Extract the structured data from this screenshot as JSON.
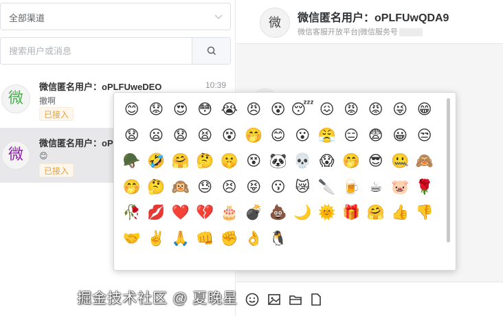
{
  "left": {
    "channel_select": {
      "value": "全部渠道"
    },
    "search": {
      "placeholder": "搜索用户或消息"
    },
    "conversations": [
      {
        "avatar": "微",
        "avatar_color": "#4caf50",
        "name": "微信匿名用户：oPLFUweDEO",
        "time": "10:39",
        "message": "撤啊",
        "badge": "已接入",
        "active": false
      },
      {
        "avatar": "微",
        "avatar_color": "#8e24aa",
        "name": "微信匿名用户：oPLFU",
        "time": "",
        "message": "😊",
        "badge": "已接入",
        "active": true
      }
    ]
  },
  "chat": {
    "avatar": "微",
    "title": "微信匿名用户：oPLFUwQDA9",
    "subtitle": "微信客服开放平台|微信服务号"
  },
  "emoji_picker": {
    "emojis": [
      "😊",
      "😟",
      "😍",
      "😳",
      "😭",
      "😠",
      "😵",
      "😴",
      "😖",
      "😡",
      "😡",
      "😜",
      "😁",
      "😧",
      "😦",
      "😧",
      "😫",
      "😵",
      "🤭",
      "😊",
      "😮",
      "😤",
      "😑",
      "😨",
      "😀",
      "😒",
      "🪖",
      "🤣",
      "🤗",
      "🤔",
      "🤫",
      "😵",
      "🐼",
      "💀",
      "😱",
      "🤭",
      "😎",
      "🤐",
      "🙈",
      "🤭",
      "🤔",
      "🙉",
      "😓",
      "😣",
      "😝",
      "😗",
      "😿",
      "🔪",
      "🍺",
      "☕",
      "🐷",
      "🌹",
      "🥀",
      "💋",
      "❤️",
      "💔",
      "🎂",
      "💣",
      "💩",
      "🌙",
      "🌞",
      "🎁",
      "🤗",
      "👍",
      "👎",
      "🤝",
      "✌️",
      "🙏",
      "👊",
      "✊",
      "👌",
      "🐧"
    ]
  },
  "toolbar": {
    "icons": [
      "smile-icon",
      "image-icon",
      "folder-icon",
      "file-icon"
    ]
  },
  "watermark": "掘金技术社区 @ 夏晚星"
}
